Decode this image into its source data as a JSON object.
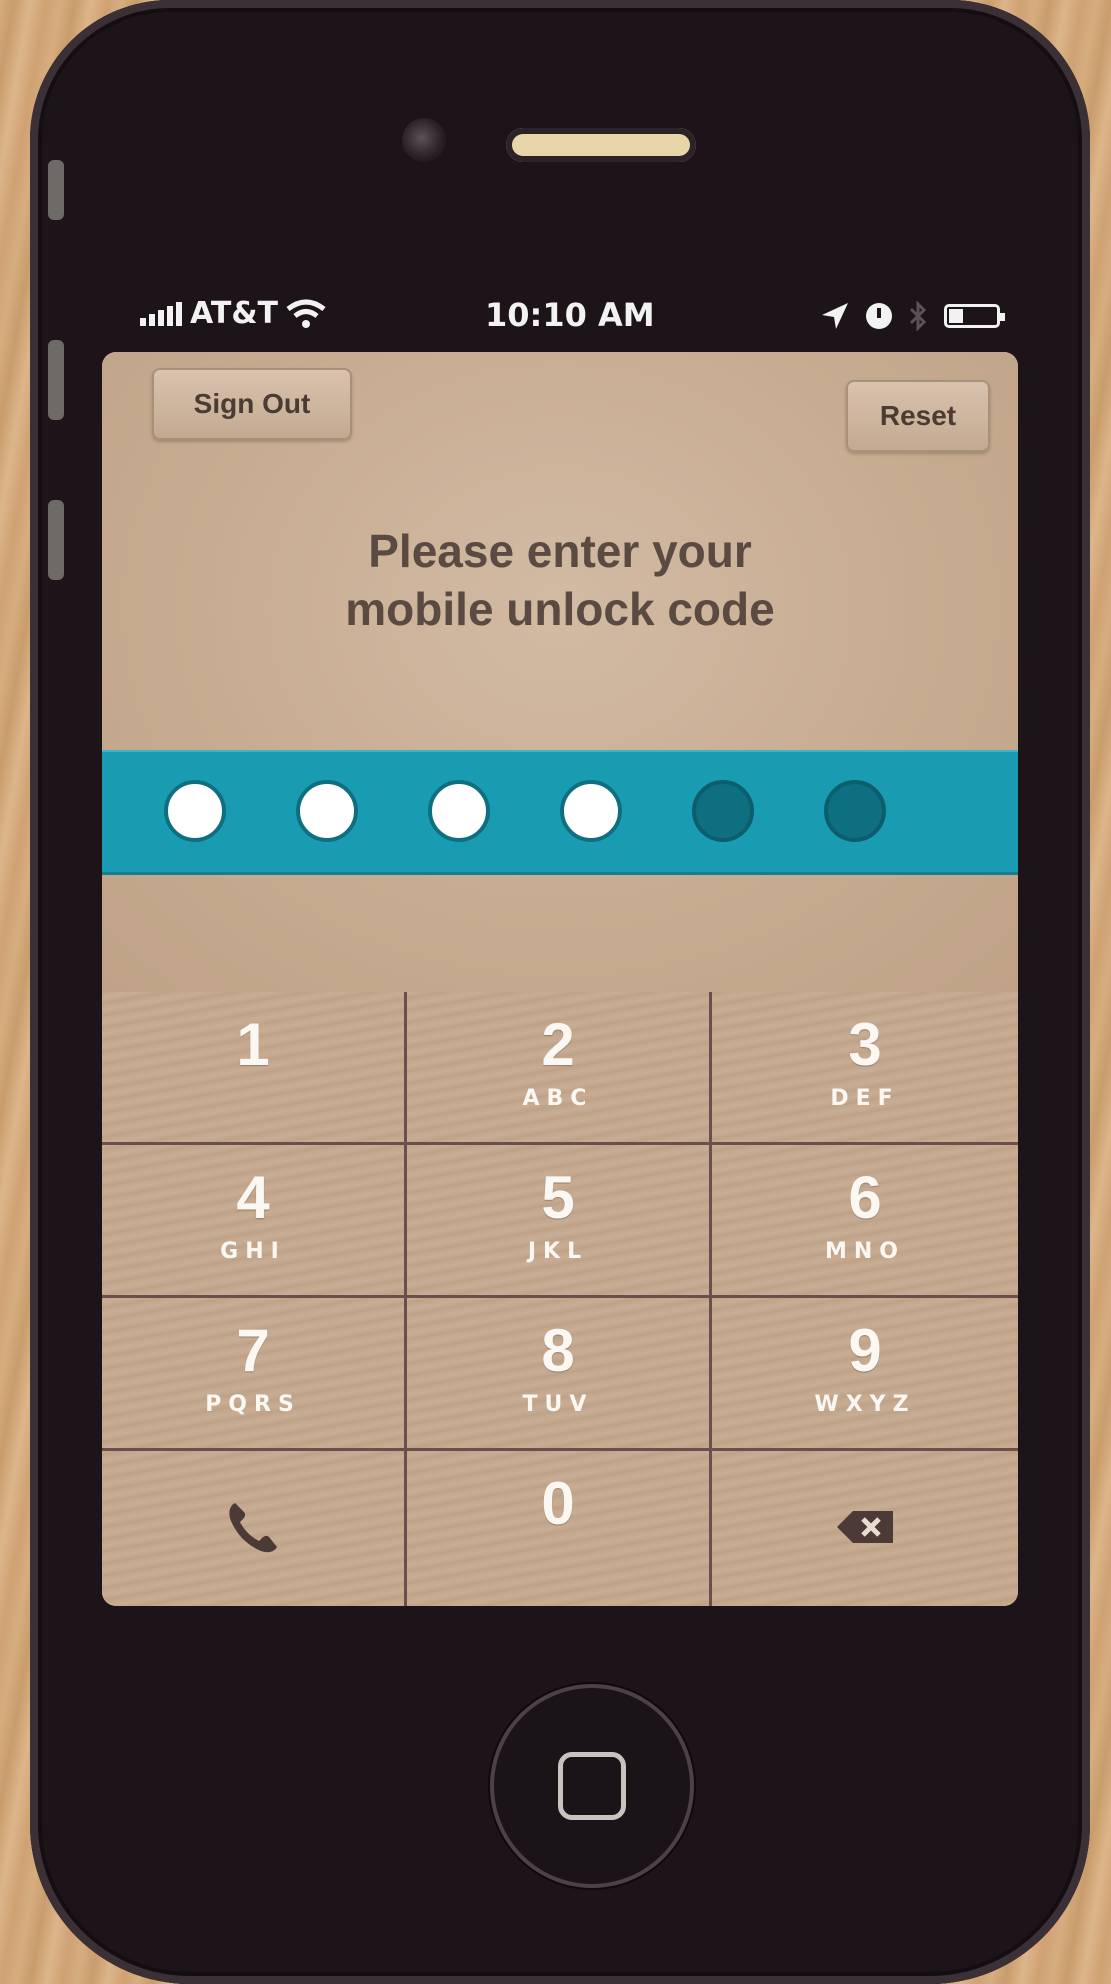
{
  "status_bar": {
    "carrier": "AT&T",
    "time": "10:10 AM",
    "signal_bars": 5,
    "battery_level": 0.3
  },
  "header": {
    "sign_out_label": "Sign Out",
    "reset_label": "Reset"
  },
  "prompt": {
    "line1": "Please enter your",
    "line2": "mobile unlock code"
  },
  "passcode": {
    "length": 6,
    "entered": 4
  },
  "keypad": {
    "keys": [
      {
        "digit": "1",
        "letters": ""
      },
      {
        "digit": "2",
        "letters": "ABC"
      },
      {
        "digit": "3",
        "letters": "DEF"
      },
      {
        "digit": "4",
        "letters": "GHI"
      },
      {
        "digit": "5",
        "letters": "JKL"
      },
      {
        "digit": "6",
        "letters": "MNO"
      },
      {
        "digit": "7",
        "letters": "PQRS"
      },
      {
        "digit": "8",
        "letters": "TUV"
      },
      {
        "digit": "9",
        "letters": "WXYZ"
      },
      {
        "digit": "0",
        "letters": ""
      }
    ],
    "call_icon": "phone-icon",
    "delete_icon": "backspace-icon"
  },
  "colors": {
    "code_bar": "#199cb1",
    "dot_filled": "#ffffff",
    "dot_empty": "#0d6f7f",
    "screen_bg": "#c8ad93"
  }
}
